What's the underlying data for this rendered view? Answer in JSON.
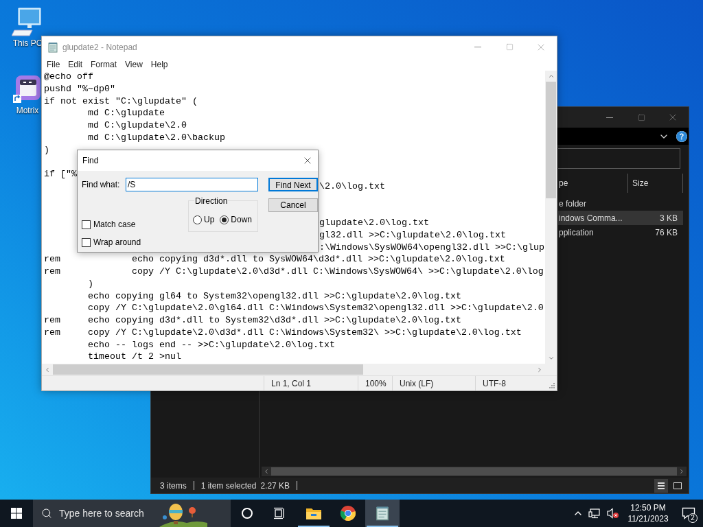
{
  "desktop_icons": [
    {
      "kind": "computer",
      "label": "This PC"
    },
    {
      "kind": "app",
      "label": "Motrix"
    }
  ],
  "explorer": {
    "columns": [
      "pe",
      "Size"
    ],
    "rows": [
      {
        "type": "e folder",
        "selected": false
      },
      {
        "type": "indows Comma...",
        "size": "3 KB",
        "selected": true
      },
      {
        "type": "pplication",
        "size": "76 KB",
        "selected": false
      }
    ],
    "status_bar": {
      "items": "3 items",
      "selection": "1 item selected",
      "selection_size": "2.27 KB"
    }
  },
  "notepad": {
    "title": "glupdate2 - Notepad",
    "menu": [
      "File",
      "Edit",
      "Format",
      "View",
      "Help"
    ],
    "lines": [
      {
        "kind": "text",
        "text": "@echo off"
      },
      {
        "kind": "text",
        "text": "pushd \"%~dp0\""
      },
      {
        "kind": "text",
        "text": "if not exist \"C:\\glupdate\" ("
      },
      {
        "kind": "text",
        "text": "\tmd C:\\glupdate"
      },
      {
        "kind": "text",
        "text": "\tmd C:\\glupdate\\2.0"
      },
      {
        "kind": "text",
        "text": "\tmd C:\\glupdate\\2.0\\backup"
      },
      {
        "kind": "text",
        "text": ")"
      },
      {
        "kind": "blank"
      },
      {
        "kind": "text",
        "text": "if [\"%"
      },
      {
        "kind": "tail",
        "text": "\\2.0\\log.txt"
      },
      {
        "kind": "blank"
      },
      {
        "kind": "blank"
      },
      {
        "kind": "tail",
        "text": "glupdate\\2.0\\log.txt"
      },
      {
        "kind": "tail",
        "text": "gl32.dll >>C:\\glupdate\\2.0\\log.txt"
      },
      {
        "kind": "tail",
        "text": ":\\Windows\\SysWOW64\\opengl32.dll >>C:\\glup"
      },
      {
        "kind": "text",
        "text": "rem\t\techo copying d3d*.dll to SysWOW64\\d3d*.dll >>C:\\glupdate\\2.0\\log.txt"
      },
      {
        "kind": "text",
        "text": "rem\t\tcopy /Y C:\\glupdate\\2.0\\d3d*.dll C:\\Windows\\SysWOW64\\ >>C:\\glupdate\\2.0\\log"
      },
      {
        "kind": "text",
        "text": "\t)"
      },
      {
        "kind": "text",
        "text": "\techo copying gl64 to System32\\opengl32.dll >>C:\\glupdate\\2.0\\log.txt"
      },
      {
        "kind": "text",
        "text": "\tcopy /Y C:\\glupdate\\2.0\\gl64.dll C:\\Windows\\System32\\opengl32.dll >>C:\\glupdate\\2.0"
      },
      {
        "kind": "text",
        "text": "rem\techo copying d3d*.dll to System32\\d3d*.dll >>C:\\glupdate\\2.0\\log.txt"
      },
      {
        "kind": "text",
        "text": "rem\tcopy /Y C:\\glupdate\\2.0\\d3d*.dll C:\\Windows\\System32\\ >>C:\\glupdate\\2.0\\log.txt"
      },
      {
        "kind": "text",
        "text": "\techo -- logs end -- >>C:\\glupdate\\2.0\\log.txt"
      },
      {
        "kind": "text",
        "text": "\ttimeout /t 2 >nul"
      }
    ],
    "status_bar": [
      "Ln 1, Col 1",
      "100%",
      "Unix (LF)",
      "UTF-8"
    ]
  },
  "find_dialog": {
    "title": "Find",
    "find_what_label": "Find what:",
    "find_what_value": "/S",
    "buttons": [
      {
        "label": "Find Next",
        "focused": true
      },
      {
        "label": "Cancel",
        "focused": false
      }
    ],
    "direction": {
      "label": "Direction",
      "options": [
        {
          "label": "Up",
          "selected": false
        },
        {
          "label": "Down",
          "selected": true
        }
      ]
    },
    "options": [
      {
        "label": "Match case",
        "checked": false
      },
      {
        "label": "Wrap around",
        "checked": false
      }
    ]
  },
  "taskbar": {
    "search_placeholder": "Type here to search",
    "apps": [
      {
        "kind": "folder",
        "running": true,
        "active": false
      },
      {
        "kind": "chrome",
        "running": false,
        "active": false
      },
      {
        "kind": "notepad",
        "running": true,
        "active": true
      }
    ],
    "clock": {
      "time": "12:50 PM",
      "date": "11/21/2023"
    },
    "notifications": "2"
  }
}
